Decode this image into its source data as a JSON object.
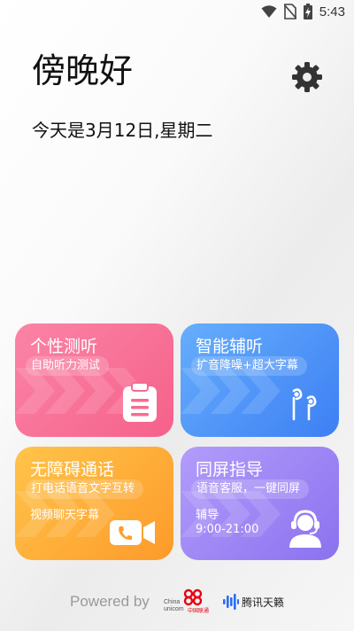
{
  "status_bar": {
    "time": "5:43",
    "icons": [
      "wifi-icon",
      "no-sim-icon",
      "battery-charging-icon"
    ]
  },
  "greeting": "傍晚好",
  "date_line": "今天是3月12日,星期二",
  "settings": {
    "icon": "gear-icon"
  },
  "cards": {
    "personal": {
      "title": "个性测听",
      "subtitle": "自助听力测试",
      "icon": "clipboard-icon",
      "color": "#f76b92"
    },
    "smart": {
      "title": "智能辅听",
      "subtitle": "扩音降噪+超大字幕",
      "icon": "earphones-icon",
      "color": "#4f93f8"
    },
    "barrier": {
      "title": "无障碍通话",
      "subtitle": "打电话语音文字互转",
      "line2": "视频聊天字幕",
      "icon": "video-call-icon",
      "color": "#feae38"
    },
    "guide": {
      "title": "同屏指导",
      "subtitle": "语音客服，一键同屏",
      "line2": "辅导",
      "hours": "9:00-21:00",
      "icon": "headset-agent-icon",
      "color": "#9d86f5"
    }
  },
  "footer": {
    "powered_by": "Powered by",
    "unicom": {
      "en1": "China",
      "en2": "unicom",
      "cn": "中国联通",
      "color": "#e60012"
    },
    "tencent": {
      "label": "腾讯天籁",
      "color": "#2b6cf6"
    }
  }
}
